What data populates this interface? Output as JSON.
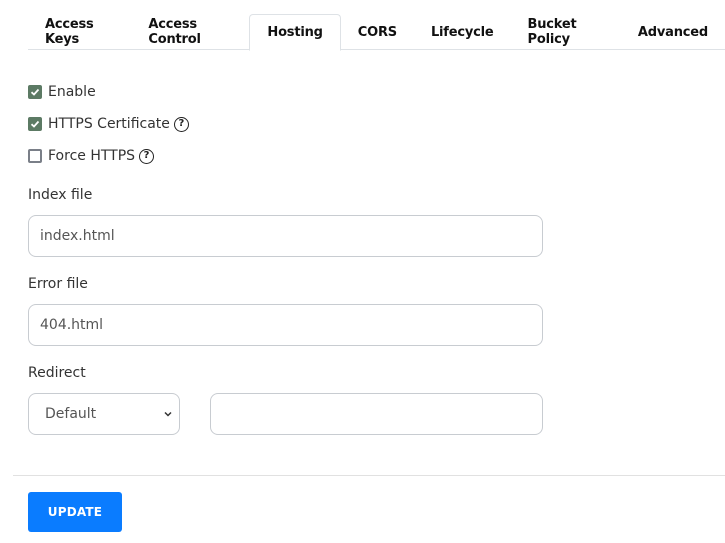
{
  "tabs": [
    {
      "label": "Access Keys",
      "active": false
    },
    {
      "label": "Access Control",
      "active": false
    },
    {
      "label": "Hosting",
      "active": true
    },
    {
      "label": "CORS",
      "active": false
    },
    {
      "label": "Lifecycle",
      "active": false
    },
    {
      "label": "Bucket Policy",
      "active": false
    },
    {
      "label": "Advanced",
      "active": false
    }
  ],
  "checkboxes": [
    {
      "label": "Enable",
      "checked": true,
      "help_icon": false
    },
    {
      "label": "HTTPS Certificate",
      "checked": true,
      "help_icon": true
    },
    {
      "label": "Force HTTPS",
      "checked": false,
      "help_icon": true
    }
  ],
  "help_glyph": "?",
  "index_file": {
    "label": "Index file",
    "value": "index.html"
  },
  "error_file": {
    "label": "Error file",
    "value": "404.html"
  },
  "redirect": {
    "label": "Redirect",
    "selected": "Default",
    "value": ""
  },
  "update_button": {
    "label": "UPDATE"
  },
  "colors": {
    "accent": "#0a7cff",
    "checkbox_checked": "#5c7a64"
  }
}
